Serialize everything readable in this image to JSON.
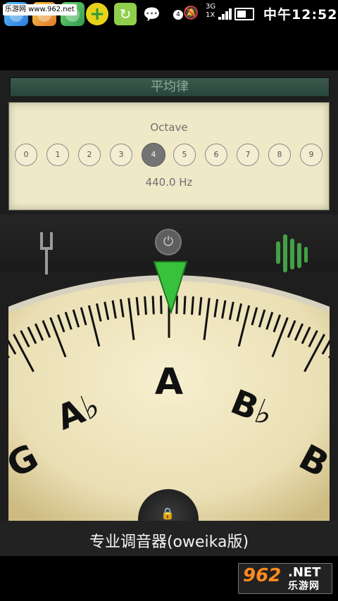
{
  "status_bar": {
    "site_label": "乐游网 www.962.net",
    "notification_count": "4",
    "network_top": "3G",
    "network_bottom": "1X",
    "time": "中午12:52",
    "icons": [
      "app-icon",
      "app-icon",
      "app-icon",
      "add-icon",
      "refresh-icon",
      "chat-icon",
      "mute-icon",
      "signal-icon",
      "battery-icon"
    ]
  },
  "tuner": {
    "temperament": "平均律",
    "octave_label": "Octave",
    "octaves": [
      "0",
      "1",
      "2",
      "3",
      "4",
      "5",
      "6",
      "7",
      "8",
      "9"
    ],
    "selected_octave_index": 4,
    "frequency": "440.0 Hz",
    "notes": {
      "g": "G",
      "ab": "A♭",
      "a": "A",
      "bb": "B♭",
      "b": "B"
    },
    "app_name": "专业调音器(oweika版)"
  },
  "watermark": {
    "num": "962",
    "net": ".NET",
    "cn": "乐游网"
  },
  "colors": {
    "needle": "#38c13d",
    "dial_face": "#efe6bf",
    "lock": "#e23b3b",
    "accent_orange": "#ff8b1e"
  }
}
